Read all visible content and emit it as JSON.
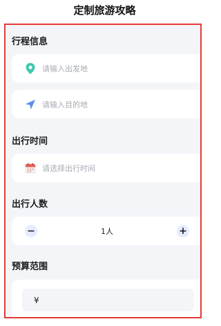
{
  "header": {
    "title": "定制旅游攻略"
  },
  "sections": {
    "itinerary": {
      "title": "行程信息",
      "departure_placeholder": "请输入出发地",
      "destination_placeholder": "请输入目的地"
    },
    "time": {
      "title": "出行时间",
      "date_placeholder": "请选择出行时间"
    },
    "people": {
      "title": "出行人数",
      "minus": "−",
      "plus": "+",
      "value": "1人"
    },
    "budget": {
      "title": "预算范围",
      "currency": "¥"
    }
  },
  "colors": {
    "accent_border": "#e53935",
    "location_pin": "#3ec6b0",
    "navigation_arrow": "#5b8def",
    "calendar_icon": "#e8605a"
  },
  "icons": {
    "departure": "location-pin-icon",
    "destination": "navigation-arrow-icon",
    "date": "calendar-icon"
  }
}
